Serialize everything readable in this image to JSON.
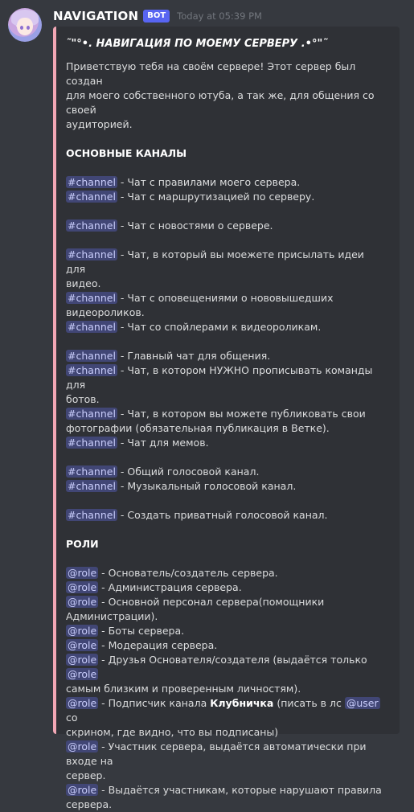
{
  "author": {
    "username": "NAVIGATION",
    "bot_tag": "BOT",
    "timestamp": "Today at 05:39 PM"
  },
  "embed": {
    "accent_color": "#f2a7b5",
    "title": "˜\"°•. НАВИГАЦИЯ ПО МОЕМУ СЕРВЕРУ .•°\"˜",
    "intro": [
      "Приветствую тебя на своём сервере! Этот сервер был создан",
      "для моего собственного ютуба, а так же, для общения со своей",
      "аудиторией."
    ],
    "channels_heading": "ОСНОВНЫЕ КАНАЛЫ",
    "channel_mention": "#channel",
    "channel_groups": [
      [
        {
          "text": " - Чат с правилами моего сервера."
        },
        {
          "text": " - Чат с маршрутизацией по серверу."
        }
      ],
      [
        {
          "text": " - Чат с новостями о сервере."
        }
      ],
      [
        {
          "text": " - Чат, в который вы моежете присылать идеи для",
          "cont": "видео."
        },
        {
          "text": " - Чат с оповещениями о нововышедших",
          "cont": "видеороликов."
        },
        {
          "text": " - Чат со спойлерами к видеороликам."
        }
      ],
      [
        {
          "text": " - Главный чат для общения."
        },
        {
          "text": " - Чат, в котором НУЖНО прописывать команды для",
          "cont": "ботов."
        },
        {
          "text": " - Чат, в котором вы можете публиковать свои",
          "cont": "фотографии (обязательная публикация в Ветке)."
        },
        {
          "text": " - Чат для мемов."
        }
      ],
      [
        {
          "text": " - Общий голосовой канал."
        },
        {
          "text": " - Музыкальный голосовой канал."
        }
      ],
      [
        {
          "text": " - Создать приватный голосовой канал."
        }
      ]
    ],
    "roles_heading": "РОЛИ",
    "role_mention": "@role",
    "user_mention": "@user",
    "roles": [
      {
        "text": " - Основатель/создатель сервера."
      },
      {
        "text": " - Администрация сервера."
      },
      {
        "text": " - Основной персонал сервера(помощники",
        "cont": "Администрации)."
      },
      {
        "text": " - Боты сервера."
      },
      {
        "text": " - Модерация сервера."
      },
      {
        "text": " - Друзья Основателя/создателя (выдаётся только ",
        "role_after": true,
        "cont": "самым близким и проверенным личностям)."
      },
      {
        "text": " - Подписчик канала ",
        "bold": "Клубничка",
        "text2": " (писать в лс ",
        "user_after": true,
        "text3": " со",
        "cont": "скрином, где видно, что вы подписаны)"
      },
      {
        "text": " - Участник сервера, выдаётся автоматически при входе на",
        "cont": "сервер."
      },
      {
        "text": " - Выдаётся участникам, которые нарушают правила",
        "cont": "сервера."
      }
    ]
  }
}
